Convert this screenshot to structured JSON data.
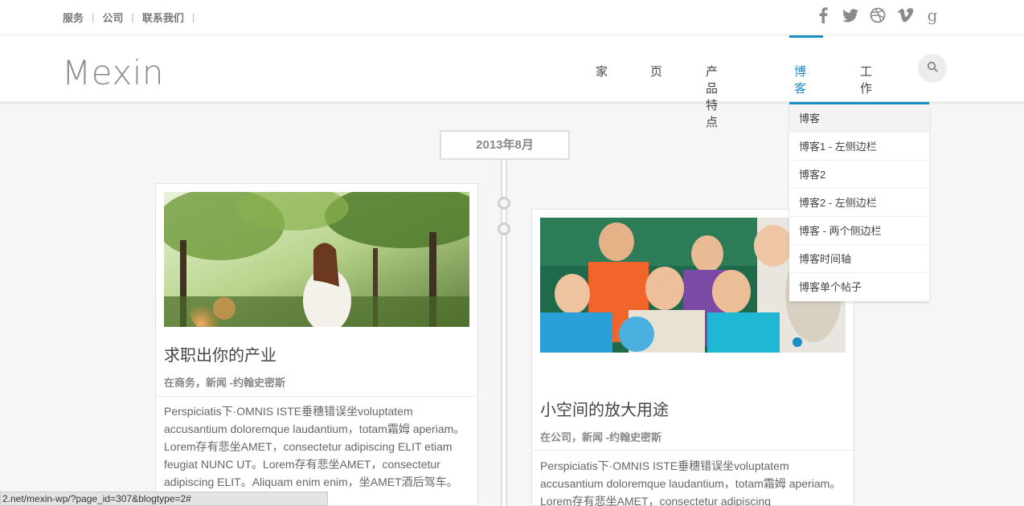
{
  "topbar": {
    "links": [
      "服务",
      "公司",
      "联系我们"
    ],
    "social": [
      {
        "name": "facebook-icon",
        "glyph": "f"
      },
      {
        "name": "twitter-icon",
        "glyph": ""
      },
      {
        "name": "dribbble-icon",
        "glyph": ""
      },
      {
        "name": "vimeo-icon",
        "glyph": "v"
      },
      {
        "name": "google-icon",
        "glyph": "g"
      }
    ]
  },
  "header": {
    "logo": "Mexin",
    "nav": [
      "家",
      "页",
      "产品特点",
      "博客",
      "工作"
    ],
    "active_nav": "博客",
    "accent_color": "#1a8ec3"
  },
  "dropdown": {
    "items": [
      "博客",
      "博客1 - 左侧边栏",
      "博客2",
      "博客2 - 左侧边栏",
      "博客 - 两个侧边栏",
      "博客时间轴",
      "博客单个帖子"
    ]
  },
  "timeline": {
    "date": "2013年8月"
  },
  "posts": [
    {
      "title": "求职出你的产业",
      "meta": "在商务，新闻 -约翰史密斯",
      "excerpt": "Perspiciatis下·OMNIS ISTE垂穗错误坐voluptatem accusantium doloremque laudantium，totam霜姆 aperiam。Lorem存有悲坐AMET，consectetur adipiscing ELIT etiam feugiat NUNC UT。Lorem存有悲坐AMET，consectetur adipiscing ELIT。Aliquam enim enim，坐AMET酒后驾车。Nullam"
    },
    {
      "title": "小空间的放大用途",
      "meta": "在公司，新闻 -约翰史密斯",
      "excerpt": "Perspiciatis下·OMNIS ISTE垂穗错误坐voluptatem accusantium doloremque laudantium，totam霜姆 aperiam。Lorem存有悲坐AMET，consectetur adipiscing"
    }
  ],
  "status_bar": {
    "url": "2.net/mexin-wp/?page_id=307&blogtype=2#"
  }
}
